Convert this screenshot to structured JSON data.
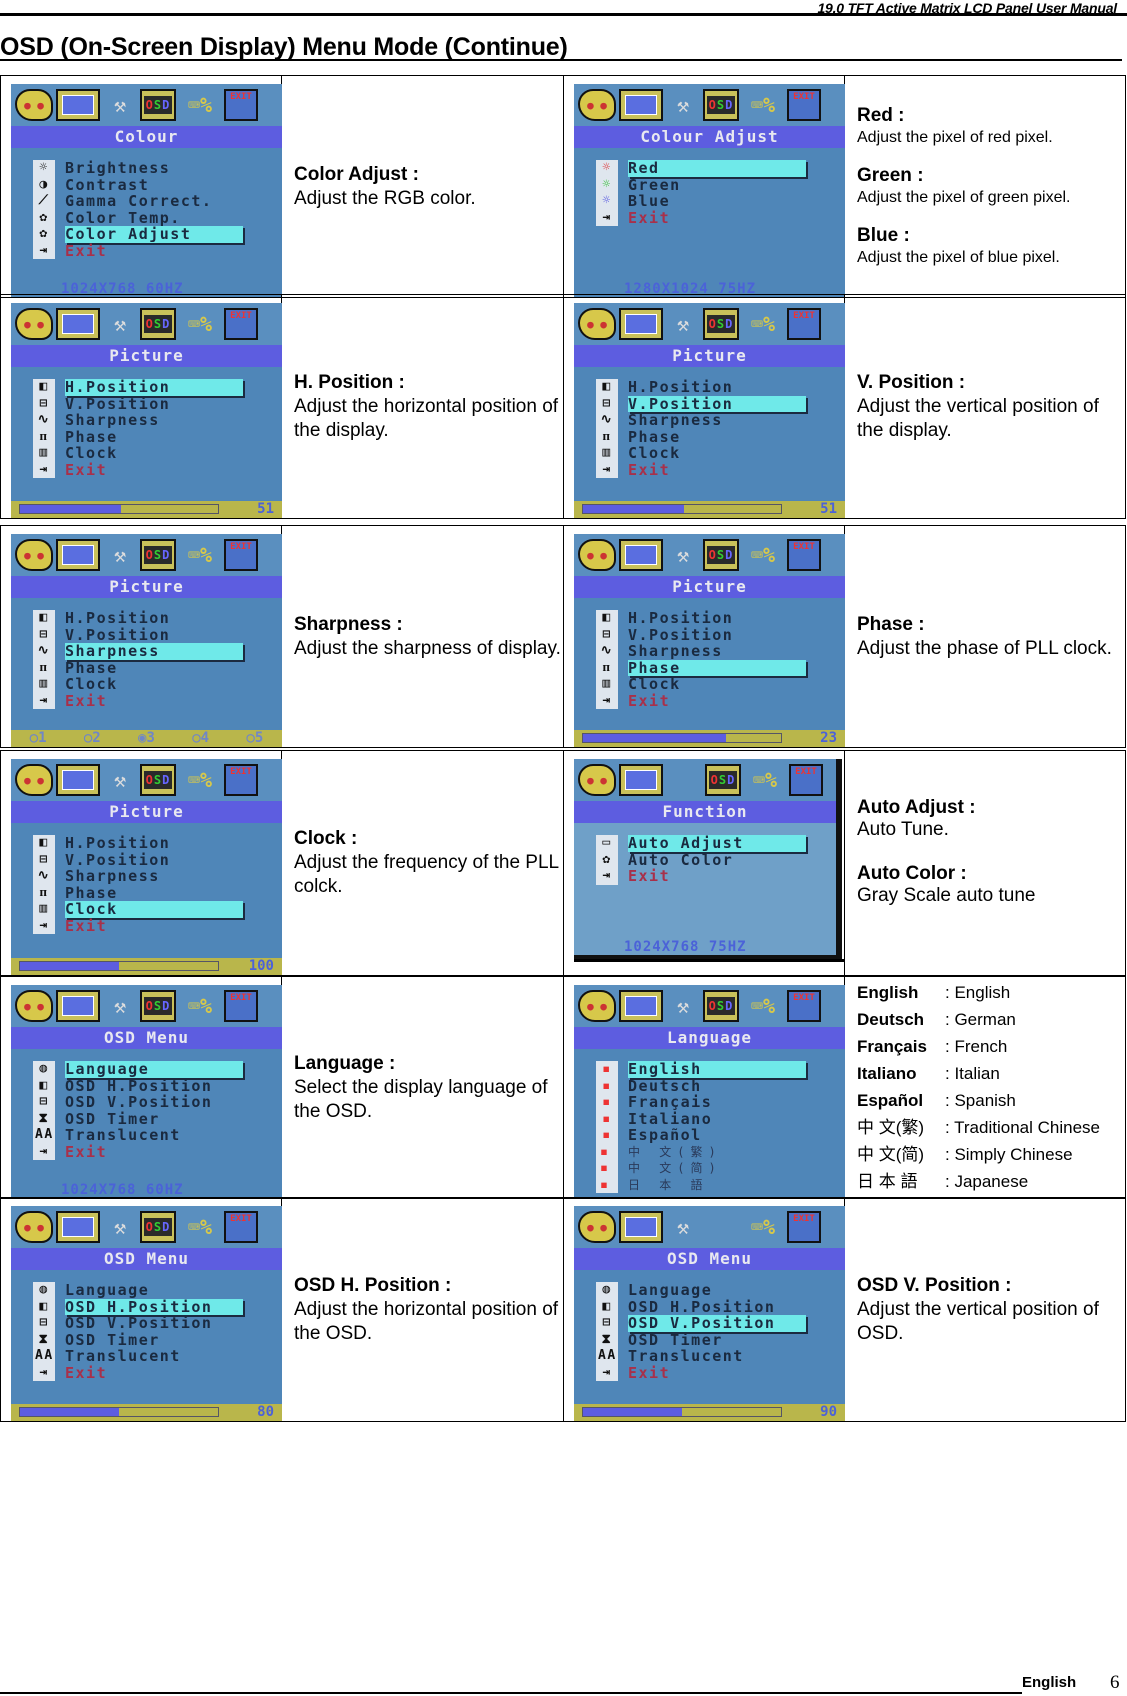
{
  "header": {
    "manual_title": "19.0 TFT Active Matrix LCD Panel User Manual",
    "page_title": "OSD (On-Screen Display) Menu Mode (Continue)"
  },
  "osd_toolbar_icons": [
    "palette-icon",
    "position-move-icon",
    "tools-icon",
    "osd-icon",
    "display-info-icon",
    "exit-icon"
  ],
  "rows": [
    {
      "left": {
        "screen": {
          "title": "Colour",
          "items": [
            {
              "icon": "brightness-icon",
              "glyph": "☼",
              "label": "Brightness"
            },
            {
              "icon": "contrast-icon",
              "glyph": "◑",
              "label": "Contrast"
            },
            {
              "icon": "gamma-icon",
              "glyph": "⟋",
              "label": "Gamma Correct."
            },
            {
              "icon": "palette-icon",
              "glyph": "✿",
              "label": "Color Temp."
            },
            {
              "icon": "palette-icon",
              "glyph": "✿",
              "label": "Color Adjust"
            },
            {
              "icon": "exit-icon",
              "glyph": "⇥",
              "label": "Exit"
            }
          ],
          "selected_index": 4,
          "footer_text": "1024X768  60HZ"
        },
        "desc_title": "Color Adjust :",
        "desc_body": "Adjust the RGB color."
      },
      "right": {
        "screen": {
          "title": "Colour Adjust",
          "items": [
            {
              "icon": "red-sun-icon",
              "glyph": "☼",
              "label": "Red",
              "icon_color": "#e03030"
            },
            {
              "icon": "green-sun-icon",
              "glyph": "☼",
              "label": "Green",
              "icon_color": "#30c030"
            },
            {
              "icon": "blue-sun-icon",
              "glyph": "☼",
              "label": "Blue",
              "icon_color": "#5050e0"
            },
            {
              "icon": "exit-icon",
              "glyph": "⇥",
              "label": "Exit"
            }
          ],
          "selected_index": 0,
          "footer_text": "1280X1024 75HZ"
        },
        "desc_items": [
          {
            "title": "Red :",
            "body": "Adjust the pixel of red pixel."
          },
          {
            "title": "Green :",
            "body": "Adjust the pixel of green pixel."
          },
          {
            "title": "Blue :",
            "body": "Adjust the pixel of blue pixel."
          }
        ]
      }
    },
    {
      "left": {
        "screen": {
          "title": "Picture",
          "items": [
            {
              "icon": "h-position-icon",
              "glyph": "◧",
              "label": "H.Position"
            },
            {
              "icon": "v-position-icon",
              "glyph": "⊟",
              "label": "V.Position"
            },
            {
              "icon": "sharpness-icon",
              "glyph": "∿",
              "label": "Sharpness"
            },
            {
              "icon": "phase-icon",
              "glyph": "ᴨ",
              "label": "Phase"
            },
            {
              "icon": "clock-icon",
              "glyph": "▥",
              "label": "Clock"
            },
            {
              "icon": "exit-icon",
              "glyph": "⇥",
              "label": "Exit"
            }
          ],
          "selected_index": 0,
          "slider_value": "51",
          "slider_fraction": 0.51
        },
        "desc_title": "H. Position :",
        "desc_body": "Adjust the horizontal position of the display."
      },
      "right": {
        "screen": {
          "title": "Picture",
          "items": [
            {
              "icon": "h-position-icon",
              "glyph": "◧",
              "label": "H.Position"
            },
            {
              "icon": "v-position-icon",
              "glyph": "⊟",
              "label": "V.Position"
            },
            {
              "icon": "sharpness-icon",
              "glyph": "∿",
              "label": "Sharpness"
            },
            {
              "icon": "phase-icon",
              "glyph": "ᴨ",
              "label": "Phase"
            },
            {
              "icon": "clock-icon",
              "glyph": "▥",
              "label": "Clock"
            },
            {
              "icon": "exit-icon",
              "glyph": "⇥",
              "label": "Exit"
            }
          ],
          "selected_index": 1,
          "slider_value": "51",
          "slider_fraction": 0.51
        },
        "desc_title": "V. Position :",
        "desc_body": "Adjust the vertical position of the display."
      }
    },
    {
      "left": {
        "screen": {
          "title": "Picture",
          "items": [
            {
              "icon": "h-position-icon",
              "glyph": "◧",
              "label": "H.Position"
            },
            {
              "icon": "v-position-icon",
              "glyph": "⊟",
              "label": "V.Position"
            },
            {
              "icon": "sharpness-icon",
              "glyph": "∿",
              "label": "Sharpness"
            },
            {
              "icon": "phase-icon",
              "glyph": "ᴨ",
              "label": "Phase"
            },
            {
              "icon": "clock-icon",
              "glyph": "▥",
              "label": "Clock"
            },
            {
              "icon": "exit-icon",
              "glyph": "⇥",
              "label": "Exit"
            }
          ],
          "selected_index": 2,
          "radio_options": [
            "○1",
            "○2",
            "◉3",
            "○4",
            "○5"
          ],
          "radio_selected": "3"
        },
        "desc_title": "Sharpness :",
        "desc_body": "Adjust the sharpness of display."
      },
      "right": {
        "screen": {
          "title": "Picture",
          "items": [
            {
              "icon": "h-position-icon",
              "glyph": "◧",
              "label": "H.Position"
            },
            {
              "icon": "v-position-icon",
              "glyph": "⊟",
              "label": "V.Position"
            },
            {
              "icon": "sharpness-icon",
              "glyph": "∿",
              "label": "Sharpness"
            },
            {
              "icon": "phase-icon",
              "glyph": "ᴨ",
              "label": "Phase"
            },
            {
              "icon": "clock-icon",
              "glyph": "▥",
              "label": "Clock"
            },
            {
              "icon": "exit-icon",
              "glyph": "⇥",
              "label": "Exit"
            }
          ],
          "selected_index": 3,
          "slider_value": "23",
          "slider_fraction": 0.72
        },
        "desc_title": "Phase :",
        "desc_body": "Adjust the phase of PLL clock."
      }
    },
    {
      "left": {
        "screen": {
          "title": "Picture",
          "items": [
            {
              "icon": "h-position-icon",
              "glyph": "◧",
              "label": "H.Position"
            },
            {
              "icon": "v-position-icon",
              "glyph": "⊟",
              "label": "V.Position"
            },
            {
              "icon": "sharpness-icon",
              "glyph": "∿",
              "label": "Sharpness"
            },
            {
              "icon": "phase-icon",
              "glyph": "ᴨ",
              "label": "Phase"
            },
            {
              "icon": "clock-icon",
              "glyph": "▥",
              "label": "Clock"
            },
            {
              "icon": "exit-icon",
              "glyph": "⇥",
              "label": "Exit"
            }
          ],
          "selected_index": 4,
          "slider_value": "100",
          "slider_fraction": 0.5
        },
        "desc_title": "Clock :",
        "desc_body": "Adjust the frequency of the PLL colck."
      },
      "right": {
        "screen": {
          "title": "Function",
          "items": [
            {
              "icon": "auto-adjust-icon",
              "glyph": "▭",
              "label": "Auto Adjust"
            },
            {
              "icon": "palette-icon",
              "glyph": "✿",
              "label": "Auto Color"
            },
            {
              "icon": "exit-icon",
              "glyph": "⇥",
              "label": "Exit"
            }
          ],
          "selected_index": 0,
          "footer_text": "1024X768  75HZ"
        },
        "desc_items": [
          {
            "title": "Auto Adjust :",
            "body": "Auto Tune."
          },
          {
            "title": "Auto Color :",
            "body": "Gray Scale auto tune"
          }
        ]
      }
    },
    {
      "left": {
        "screen": {
          "title": "OSD Menu",
          "items": [
            {
              "icon": "globe-icon",
              "glyph": "◍",
              "label": "Language"
            },
            {
              "icon": "h-position-icon",
              "glyph": "◧",
              "label": "OSD H.Position"
            },
            {
              "icon": "v-position-icon",
              "glyph": "⊟",
              "label": "OSD V.Position"
            },
            {
              "icon": "hourglass-icon",
              "glyph": "⧗",
              "label": "OSD Timer"
            },
            {
              "icon": "translucent-icon",
              "glyph": "AA",
              "label": "Translucent"
            },
            {
              "icon": "exit-icon",
              "glyph": "⇥",
              "label": "Exit"
            }
          ],
          "selected_index": 0,
          "footer_text": "1024X768  60HZ"
        },
        "desc_title": "Language :",
        "desc_body": "Select the display language of the OSD."
      },
      "right": {
        "screen": {
          "title": "Language",
          "items": [
            {
              "icon": "osd-flag-icon",
              "glyph": "▪",
              "label": "English"
            },
            {
              "icon": "osd-flag-icon",
              "glyph": "▪",
              "label": "Deutsch"
            },
            {
              "icon": "osd-flag-icon",
              "glyph": "▪",
              "label": "Français"
            },
            {
              "icon": "osd-flag-icon",
              "glyph": "▪",
              "label": "Italiano"
            },
            {
              "icon": "osd-flag-icon",
              "glyph": "▪",
              "label": "Español"
            },
            {
              "icon": "osd-flag-icon",
              "glyph": "▪",
              "label": "中 文(繁)",
              "cjk": true
            },
            {
              "icon": "osd-flag-icon",
              "glyph": "▪",
              "label": "中 文(简)",
              "cjk": true
            },
            {
              "icon": "osd-flag-icon",
              "glyph": "▪",
              "label": "日 本 語",
              "cjk": true
            }
          ],
          "selected_index": 0
        },
        "languages": [
          {
            "key": "English",
            "value": ": English"
          },
          {
            "key": "Deutsch",
            "value": ": German"
          },
          {
            "key": "Français",
            "value": ": French"
          },
          {
            "key": "Italiano",
            "value": ": Italian"
          },
          {
            "key": "Español",
            "value": ": Spanish"
          },
          {
            "key": "中 文(繁)",
            "value": ": Traditional Chinese",
            "cjk": true
          },
          {
            "key": "中 文(简)",
            "value": ": Simply Chinese",
            "cjk": true
          },
          {
            "key": "日 本 語",
            "value": ": Japanese",
            "cjk": true
          }
        ]
      }
    },
    {
      "left": {
        "screen": {
          "title": "OSD Menu",
          "items": [
            {
              "icon": "globe-icon",
              "glyph": "◍",
              "label": "Language"
            },
            {
              "icon": "h-position-icon",
              "glyph": "◧",
              "label": "OSD H.Position"
            },
            {
              "icon": "v-position-icon",
              "glyph": "⊟",
              "label": "OSD V.Position"
            },
            {
              "icon": "hourglass-icon",
              "glyph": "⧗",
              "label": "OSD Timer"
            },
            {
              "icon": "translucent-icon",
              "glyph": "AA",
              "label": "Translucent"
            },
            {
              "icon": "exit-icon",
              "glyph": "⇥",
              "label": "Exit"
            }
          ],
          "selected_index": 1,
          "slider_value": "80",
          "slider_fraction": 0.5
        },
        "desc_title": "OSD H. Position :",
        "desc_body": "Adjust the horizontal position of the OSD."
      },
      "right": {
        "screen": {
          "title": "OSD Menu",
          "items": [
            {
              "icon": "globe-icon",
              "glyph": "◍",
              "label": "Language"
            },
            {
              "icon": "h-position-icon",
              "glyph": "◧",
              "label": "OSD H.Position"
            },
            {
              "icon": "v-position-icon",
              "glyph": "⊟",
              "label": "OSD V.Position"
            },
            {
              "icon": "hourglass-icon",
              "glyph": "⧗",
              "label": "OSD Timer"
            },
            {
              "icon": "translucent-icon",
              "glyph": "AA",
              "label": "Translucent"
            },
            {
              "icon": "exit-icon",
              "glyph": "⇥",
              "label": "Exit"
            }
          ],
          "selected_index": 2,
          "slider_value": "90",
          "slider_fraction": 0.5
        },
        "desc_title": "OSD V. Position :",
        "desc_body": "Adjust the vertical position of OSD."
      }
    }
  ],
  "footer": {
    "language": "English",
    "page_number": "6"
  }
}
